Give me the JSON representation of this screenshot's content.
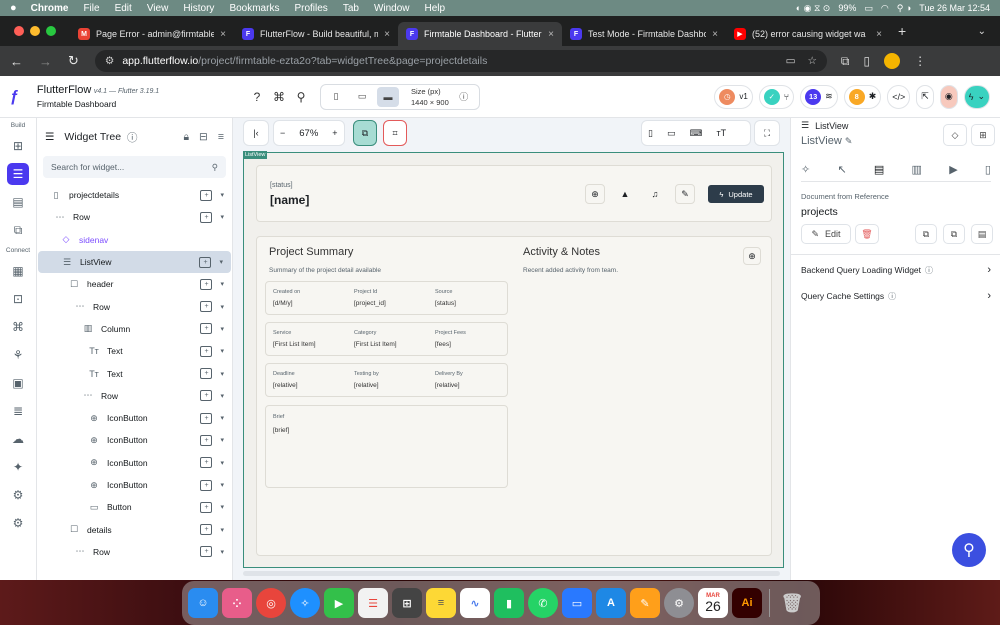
{
  "menubar": {
    "app": "Chrome",
    "items": [
      "File",
      "Edit",
      "View",
      "History",
      "Bookmarks",
      "Profiles",
      "Tab",
      "Window",
      "Help"
    ],
    "battery": "99%",
    "clock": "Tue 26 Mar  12:54"
  },
  "tabs": [
    {
      "title": "Page Error - admin@firmtable",
      "icon": "gmail-icon",
      "color": "#ea4335",
      "glyph": "M"
    },
    {
      "title": "FlutterFlow - Build beautiful, m",
      "icon": "flutterflow-icon",
      "color": "#4b39ef",
      "glyph": "F"
    },
    {
      "title": "Firmtable Dashboard - Flutter",
      "icon": "flutterflow-icon",
      "color": "#4b39ef",
      "glyph": "F",
      "active": true
    },
    {
      "title": "Test Mode - Firmtable Dashbo",
      "icon": "flutterflow-icon",
      "color": "#4b39ef",
      "glyph": "F"
    },
    {
      "title": "(52) error causing widget wa",
      "icon": "youtube-icon",
      "color": "#ff0000",
      "glyph": "▶"
    }
  ],
  "url": {
    "host": "app.flutterflow.io",
    "path": "/project/firmtable-ezta2o?tab=widgetTree&page=projectdetails"
  },
  "ff": {
    "brand": "FlutterFlow",
    "version": "v4.1 — Flutter 3.19.1",
    "project": "Firmtable Dashboard",
    "size_label": "Size (px)",
    "size_value": "1440 × 900",
    "badge_v": "v1",
    "badge_13": "13",
    "badge_8": "8"
  },
  "rail": {
    "build": "Build",
    "connect": "Connect"
  },
  "tree": {
    "title": "Widget Tree",
    "search_placeholder": "Search for widget...",
    "rows": [
      {
        "label": "projectdetails",
        "indent": 12,
        "icon": "page-icon",
        "glyph": "▯"
      },
      {
        "label": "Row",
        "indent": 16,
        "icon": "row-icon",
        "glyph": "⋯"
      },
      {
        "label": "sidenav",
        "indent": 22,
        "icon": "component-icon",
        "glyph": "◇",
        "purple": true
      },
      {
        "label": "ListView",
        "indent": 22,
        "icon": "listview-icon",
        "glyph": "☰",
        "selected": true
      },
      {
        "label": "header",
        "indent": 30,
        "icon": "container-icon",
        "glyph": "☐"
      },
      {
        "label": "Row",
        "indent": 36,
        "icon": "row-icon",
        "glyph": "⋯"
      },
      {
        "label": "Column",
        "indent": 44,
        "icon": "column-icon",
        "glyph": "▥"
      },
      {
        "label": "Text",
        "indent": 50,
        "icon": "text-icon",
        "glyph": "Tт"
      },
      {
        "label": "Text",
        "indent": 50,
        "icon": "text-icon",
        "glyph": "Tт"
      },
      {
        "label": "Row",
        "indent": 44,
        "icon": "row-icon",
        "glyph": "⋯"
      },
      {
        "label": "IconButton",
        "indent": 50,
        "icon": "iconbutton-icon",
        "glyph": "⊕"
      },
      {
        "label": "IconButton",
        "indent": 50,
        "icon": "iconbutton-icon",
        "glyph": "⊕"
      },
      {
        "label": "IconButton",
        "indent": 50,
        "icon": "iconbutton-icon",
        "glyph": "⊕"
      },
      {
        "label": "IconButton",
        "indent": 50,
        "icon": "iconbutton-icon",
        "glyph": "⊕"
      },
      {
        "label": "Button",
        "indent": 50,
        "icon": "button-icon",
        "glyph": "▭"
      },
      {
        "label": "details",
        "indent": 30,
        "icon": "container-icon",
        "glyph": "☐"
      },
      {
        "label": "Row",
        "indent": 36,
        "icon": "row-icon",
        "glyph": "⋯"
      }
    ]
  },
  "canvas": {
    "zoom": "67%",
    "listview_tag": "ListView",
    "header": {
      "status": "[status]",
      "name": "[name]",
      "update": "Update"
    },
    "summary": {
      "title": "Project Summary",
      "subtitle": "Summary of the project detail available",
      "rows": [
        [
          {
            "label": "Created on",
            "value": "[d/M/y]"
          },
          {
            "label": "Project Id",
            "value": "[project_id]"
          },
          {
            "label": "Source",
            "value": "[status]"
          }
        ],
        [
          {
            "label": "Service",
            "value": "[First List Item]"
          },
          {
            "label": "Category",
            "value": "[First List Item]"
          },
          {
            "label": "Project Fees",
            "value": "[fees]"
          }
        ],
        [
          {
            "label": "Deadline",
            "value": "[relative]"
          },
          {
            "label": "Testing by",
            "value": "[relative]"
          },
          {
            "label": "Delivery By",
            "value": "[relative]"
          }
        ]
      ],
      "brief_label": "Brief",
      "brief_value": "[brief]"
    },
    "activity": {
      "title": "Activity & Notes",
      "subtitle": "Recent added activity from team."
    }
  },
  "props": {
    "kind": "ListView",
    "name": "ListView",
    "doc_ref_label": "Document from Reference",
    "doc_ref_value": "projects",
    "edit": "Edit",
    "loading_widget": "Backend Query Loading Widget",
    "cache_settings": "Query Cache Settings"
  },
  "dock": {
    "date_month": "MAR",
    "date_day": "26"
  }
}
